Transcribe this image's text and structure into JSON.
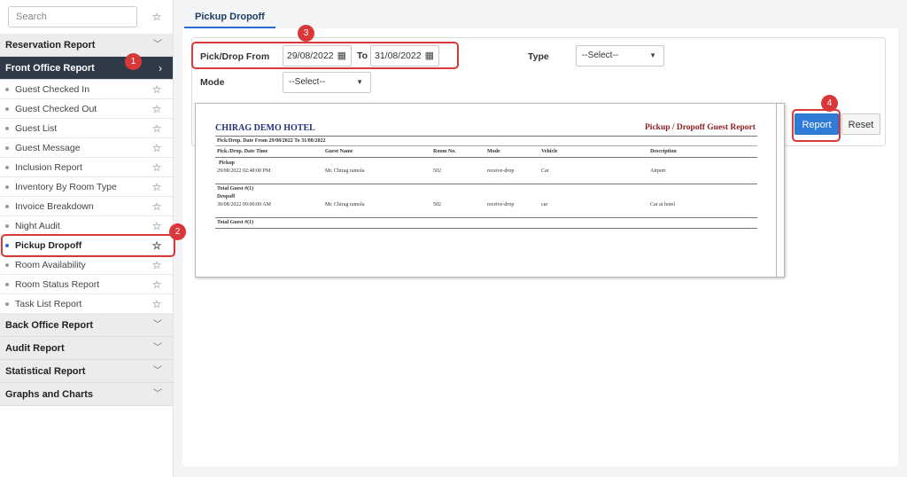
{
  "sidebar": {
    "search_placeholder": "Search",
    "groups": {
      "reservation": "Reservation Report",
      "front_office": "Front Office Report",
      "back_office": "Back Office Report",
      "audit": "Audit Report",
      "statistical": "Statistical Report",
      "graphs": "Graphs and Charts"
    },
    "items": [
      "Guest Checked In",
      "Guest Checked Out",
      "Guest List",
      "Guest Message",
      "Inclusion Report",
      "Inventory By Room Type",
      "Invoice Breakdown",
      "Night Audit",
      "Pickup Dropoff",
      "Room Availability",
      "Room Status Report",
      "Task List Report"
    ],
    "selected_item": "Pickup Dropoff"
  },
  "main": {
    "tab_label": "Pickup Dropoff",
    "form": {
      "from_label": "Pick/Drop From",
      "from_date": "29/08/2022",
      "to_label": "To",
      "to_date": "31/08/2022",
      "type_label": "Type",
      "type_value": "--Select--",
      "mode_label": "Mode",
      "mode_value": "--Select--"
    },
    "report_button": "Report",
    "reset_button": "Reset"
  },
  "preview": {
    "hotel_name": "CHIRAG DEMO HOTEL",
    "report_title": "Pickup / Dropoff Guest Report",
    "date_range": "Pick/Drop. Date From 29/08/2022   To 31/08/2022",
    "columns": [
      "Pick./Drop. Date Time",
      "Guest Name",
      "Room No.",
      "Mode",
      "Vehicle",
      "Description"
    ],
    "sections": [
      {
        "name": "Pickup",
        "row": [
          "29/08/2022 02:48:00 PM",
          "Mr. Chirag ramola",
          "502",
          "receive-drop",
          "Car",
          "Airport"
        ],
        "total": "Total Guest #(1)"
      },
      {
        "name": "Dropoff",
        "row": [
          "30/08/2022 09:00:00 AM",
          "Mr. Chirag ramola",
          "502",
          "receive-drop",
          "car",
          "Car at hotel"
        ],
        "total": "Total Guest #(1)"
      }
    ]
  },
  "annotations": [
    "1",
    "2",
    "3",
    "4"
  ],
  "icons": {
    "star": "star-outline-icon",
    "calendar": "calendar-icon",
    "chevron": "chevron-icon",
    "caret": "caret-down-icon"
  },
  "colors": {
    "active_group_bg": "#2f3a49",
    "primary_button": "#2e7bd8",
    "highlight": "#d93838",
    "hotel_name": "#23317a",
    "report_title": "#8a1c1c"
  }
}
